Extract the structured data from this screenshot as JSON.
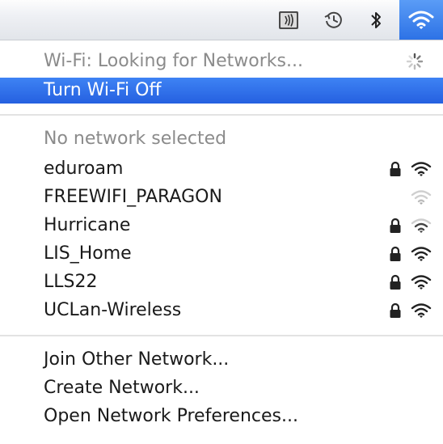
{
  "menubar": {
    "icons": [
      "airplay-icon",
      "time-machine-icon",
      "bluetooth-icon",
      "wifi-icon"
    ],
    "accent_color": "#3b7ff0"
  },
  "menu": {
    "status_label": "Wi-Fi: Looking for Networks...",
    "toggle_label": "Turn Wi-Fi Off",
    "network_header": "No network selected",
    "networks": [
      {
        "name": "eduroam",
        "locked": true,
        "signal": "strong"
      },
      {
        "name": "FREEWIFI_PARAGON",
        "locked": false,
        "signal": "weak"
      },
      {
        "name": "Hurricane",
        "locked": true,
        "signal": "medium"
      },
      {
        "name": "LIS_Home",
        "locked": true,
        "signal": "strong"
      },
      {
        "name": "LLS22",
        "locked": true,
        "signal": "strong"
      },
      {
        "name": "UCLan-Wireless",
        "locked": true,
        "signal": "strong"
      }
    ],
    "join_other_label": "Join Other Network...",
    "create_network_label": "Create Network...",
    "open_prefs_label": "Open Network Preferences..."
  }
}
